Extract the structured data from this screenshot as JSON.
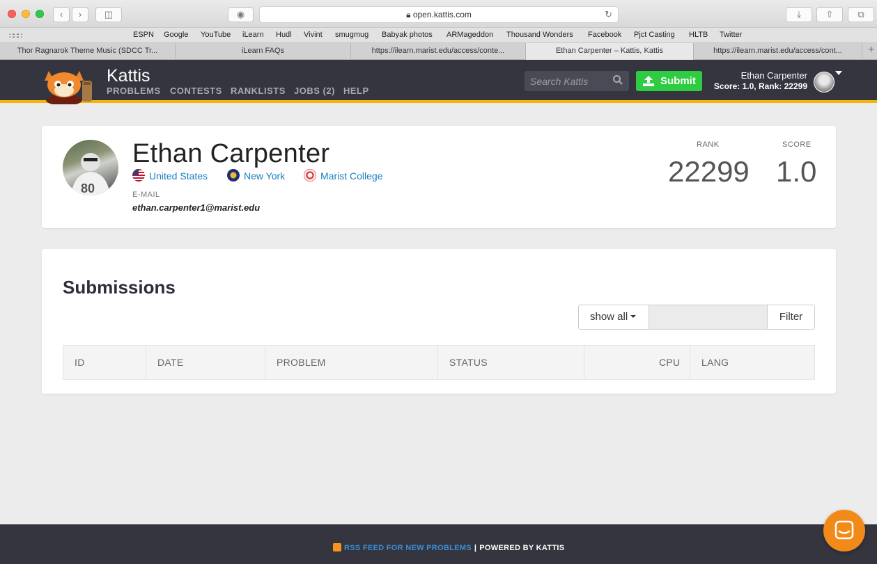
{
  "browser": {
    "url": "open.kattis.com",
    "bookmarks": [
      "ESPN",
      "Google",
      "YouTube",
      "iLearn",
      "Hudl",
      "Vivint",
      "smugmug",
      "Babyak photos",
      "ARMageddon",
      "Thousand Wonders",
      "Facebook",
      "Pjct Casting",
      "HLTB",
      "Twitter"
    ],
    "tabs": [
      {
        "label": "Thor Ragnarok Theme Music (SDCC Tr...",
        "active": false
      },
      {
        "label": "iLearn FAQs",
        "active": false
      },
      {
        "label": "https://ilearn.marist.edu/access/conte...",
        "active": false
      },
      {
        "label": "Ethan Carpenter – Kattis, Kattis",
        "active": true
      },
      {
        "label": "https://ilearn.marist.edu/access/cont...",
        "active": false
      }
    ]
  },
  "header": {
    "brand": "Kattis",
    "nav": [
      "PROBLEMS",
      "CONTESTS",
      "RANKLISTS",
      "JOBS (2)",
      "HELP"
    ],
    "search_placeholder": "Search Kattis",
    "submit_label": "Submit",
    "user_name": "Ethan Carpenter",
    "user_score": "Score: 1.0, Rank: 22299"
  },
  "profile": {
    "name": "Ethan Carpenter",
    "country": "United States",
    "state": "New York",
    "school": "Marist College",
    "email_label": "E-MAIL",
    "email": "ethan.carpenter1@marist.edu",
    "rank_label": "RANK",
    "rank": "22299",
    "score_label": "SCORE",
    "score": "1.0"
  },
  "submissions": {
    "title": "Submissions",
    "show_all": "show all",
    "filter_label": "Filter",
    "columns": [
      "ID",
      "DATE",
      "PROBLEM",
      "STATUS",
      "CPU",
      "LANG"
    ]
  },
  "footer": {
    "rss": "RSS FEED FOR NEW PROBLEMS",
    "separator": "|",
    "powered": "POWERED BY KATTIS"
  },
  "colors": {
    "header_bg": "#34353f",
    "accent": "#f5b40b",
    "submit_green": "#2ecc40",
    "link_blue": "#1a7fc1",
    "chat_orange": "#f28a19"
  }
}
